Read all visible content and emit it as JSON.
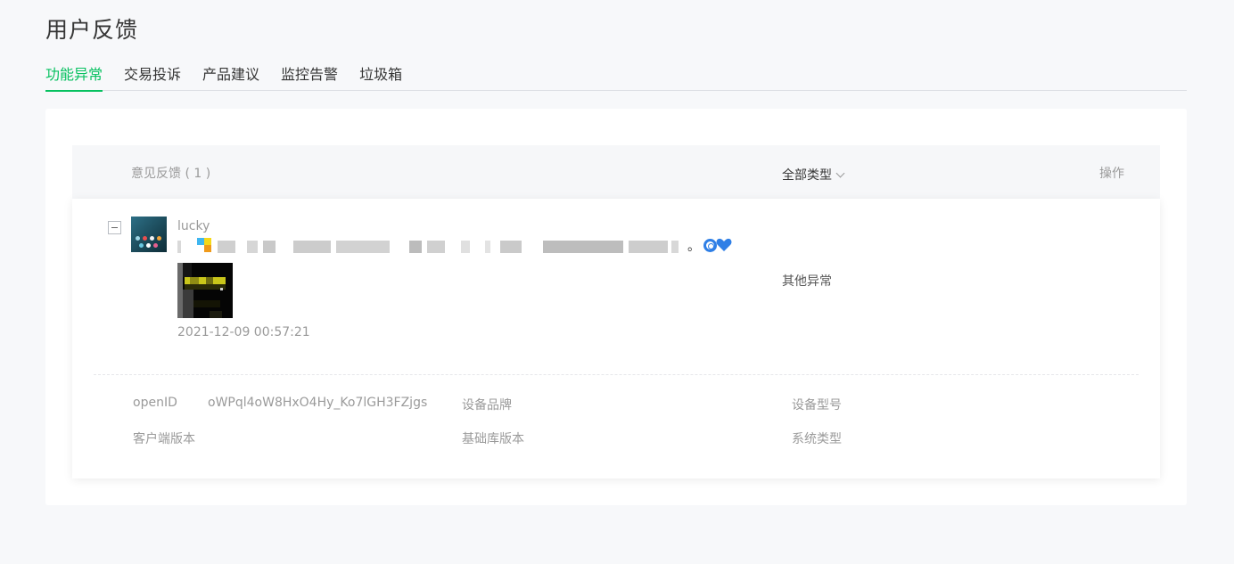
{
  "page": {
    "title": "用户反馈"
  },
  "tabs": [
    {
      "label": "功能异常",
      "active": true
    },
    {
      "label": "交易投诉",
      "active": false
    },
    {
      "label": "产品建议",
      "active": false
    },
    {
      "label": "监控告警",
      "active": false
    },
    {
      "label": "垃圾箱",
      "active": false
    }
  ],
  "table": {
    "header": {
      "feedback": "意见反馈 ( 1 )",
      "type_filter": "全部类型",
      "action": "操作"
    },
    "rows": [
      {
        "user": "lucky",
        "message_suffix": "。",
        "datetime": "2021-12-09 00:57:21",
        "category": "其他异常",
        "details": {
          "openid_label": "openID",
          "openid_value": "oWPql4oW8HxO4Hy_Ko7lGH3FZjgs",
          "device_brand_label": "设备品牌",
          "device_model_label": "设备型号",
          "client_version_label": "客户端版本",
          "base_lib_version_label": "基础库版本",
          "os_type_label": "系统类型"
        }
      }
    ]
  },
  "colors": {
    "accent": "#07c160",
    "text": "#353535",
    "muted": "#9a9a9a",
    "heart": "#2f7fe6"
  },
  "icons": {
    "collapse": "collapse-minus-icon",
    "dropdown": "chevron-down-icon",
    "emoji_1": "cyclone-emoji-icon",
    "emoji_2": "blue-heart-emoji-icon"
  }
}
